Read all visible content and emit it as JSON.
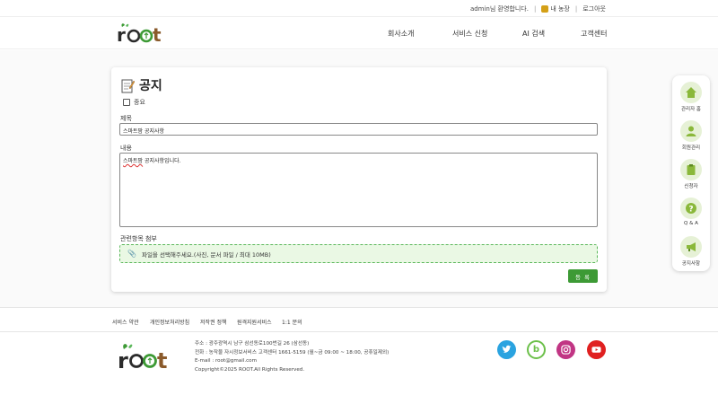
{
  "topbar": {
    "welcome": "admin님 환영합니다.",
    "my_farm": "내 농장",
    "logout": "로그아웃"
  },
  "header": {
    "nav": [
      "회사소개",
      "서비스 신청",
      "AI 검색",
      "고객센터"
    ]
  },
  "form": {
    "title": "공지",
    "important_label": "중요",
    "important_checked": false,
    "title_label": "제목",
    "title_value": "스마트팜 공지사항",
    "content_label": "내용",
    "content_prefix": "스마트팜",
    "content_rest": " 공지사항입니다.",
    "attach_label": "관련항목 첨부",
    "dropzone_text": "파일을 선택해주세요.(사진, 문서 파일 / 최대 10MB)",
    "submit_label": "등 록"
  },
  "sidebar": {
    "items": [
      {
        "label": "관리자 홈",
        "icon": "home-icon"
      },
      {
        "label": "회원관리",
        "icon": "user-icon"
      },
      {
        "label": "신청자",
        "icon": "clipboard-icon"
      },
      {
        "label": "Q & A",
        "icon": "question-icon"
      },
      {
        "label": "공지사항",
        "icon": "megaphone-icon"
      }
    ]
  },
  "footer": {
    "links": [
      "서비스 약관",
      "개인정보처리방침",
      "저작권 정책",
      "원격지원서비스",
      "1:1 문의"
    ],
    "address": "주소 : 광주광역시 남구 삼선동로100번길 26 (삼선동)",
    "phone": "전화 : 농작물 자시정보서비스 고객센터 1661-5159 (월~금 09:00 ~ 18:00, 공휴일제외)",
    "email": "E-mail : root@gmail.com",
    "copyright": "Copyright©2025 ROOT.All Rights Reserved.",
    "social": [
      "twitter-icon",
      "blog-icon",
      "instagram-icon",
      "youtube-icon"
    ]
  },
  "colors": {
    "brand_green": "#3d9a35",
    "logo_brown": "#8a5a2b",
    "dropzone_bg": "#eaf8e4",
    "twitter": "#2aa3e0",
    "blog": "#6cc04a",
    "instagram": "#c13584",
    "youtube": "#e02020"
  }
}
